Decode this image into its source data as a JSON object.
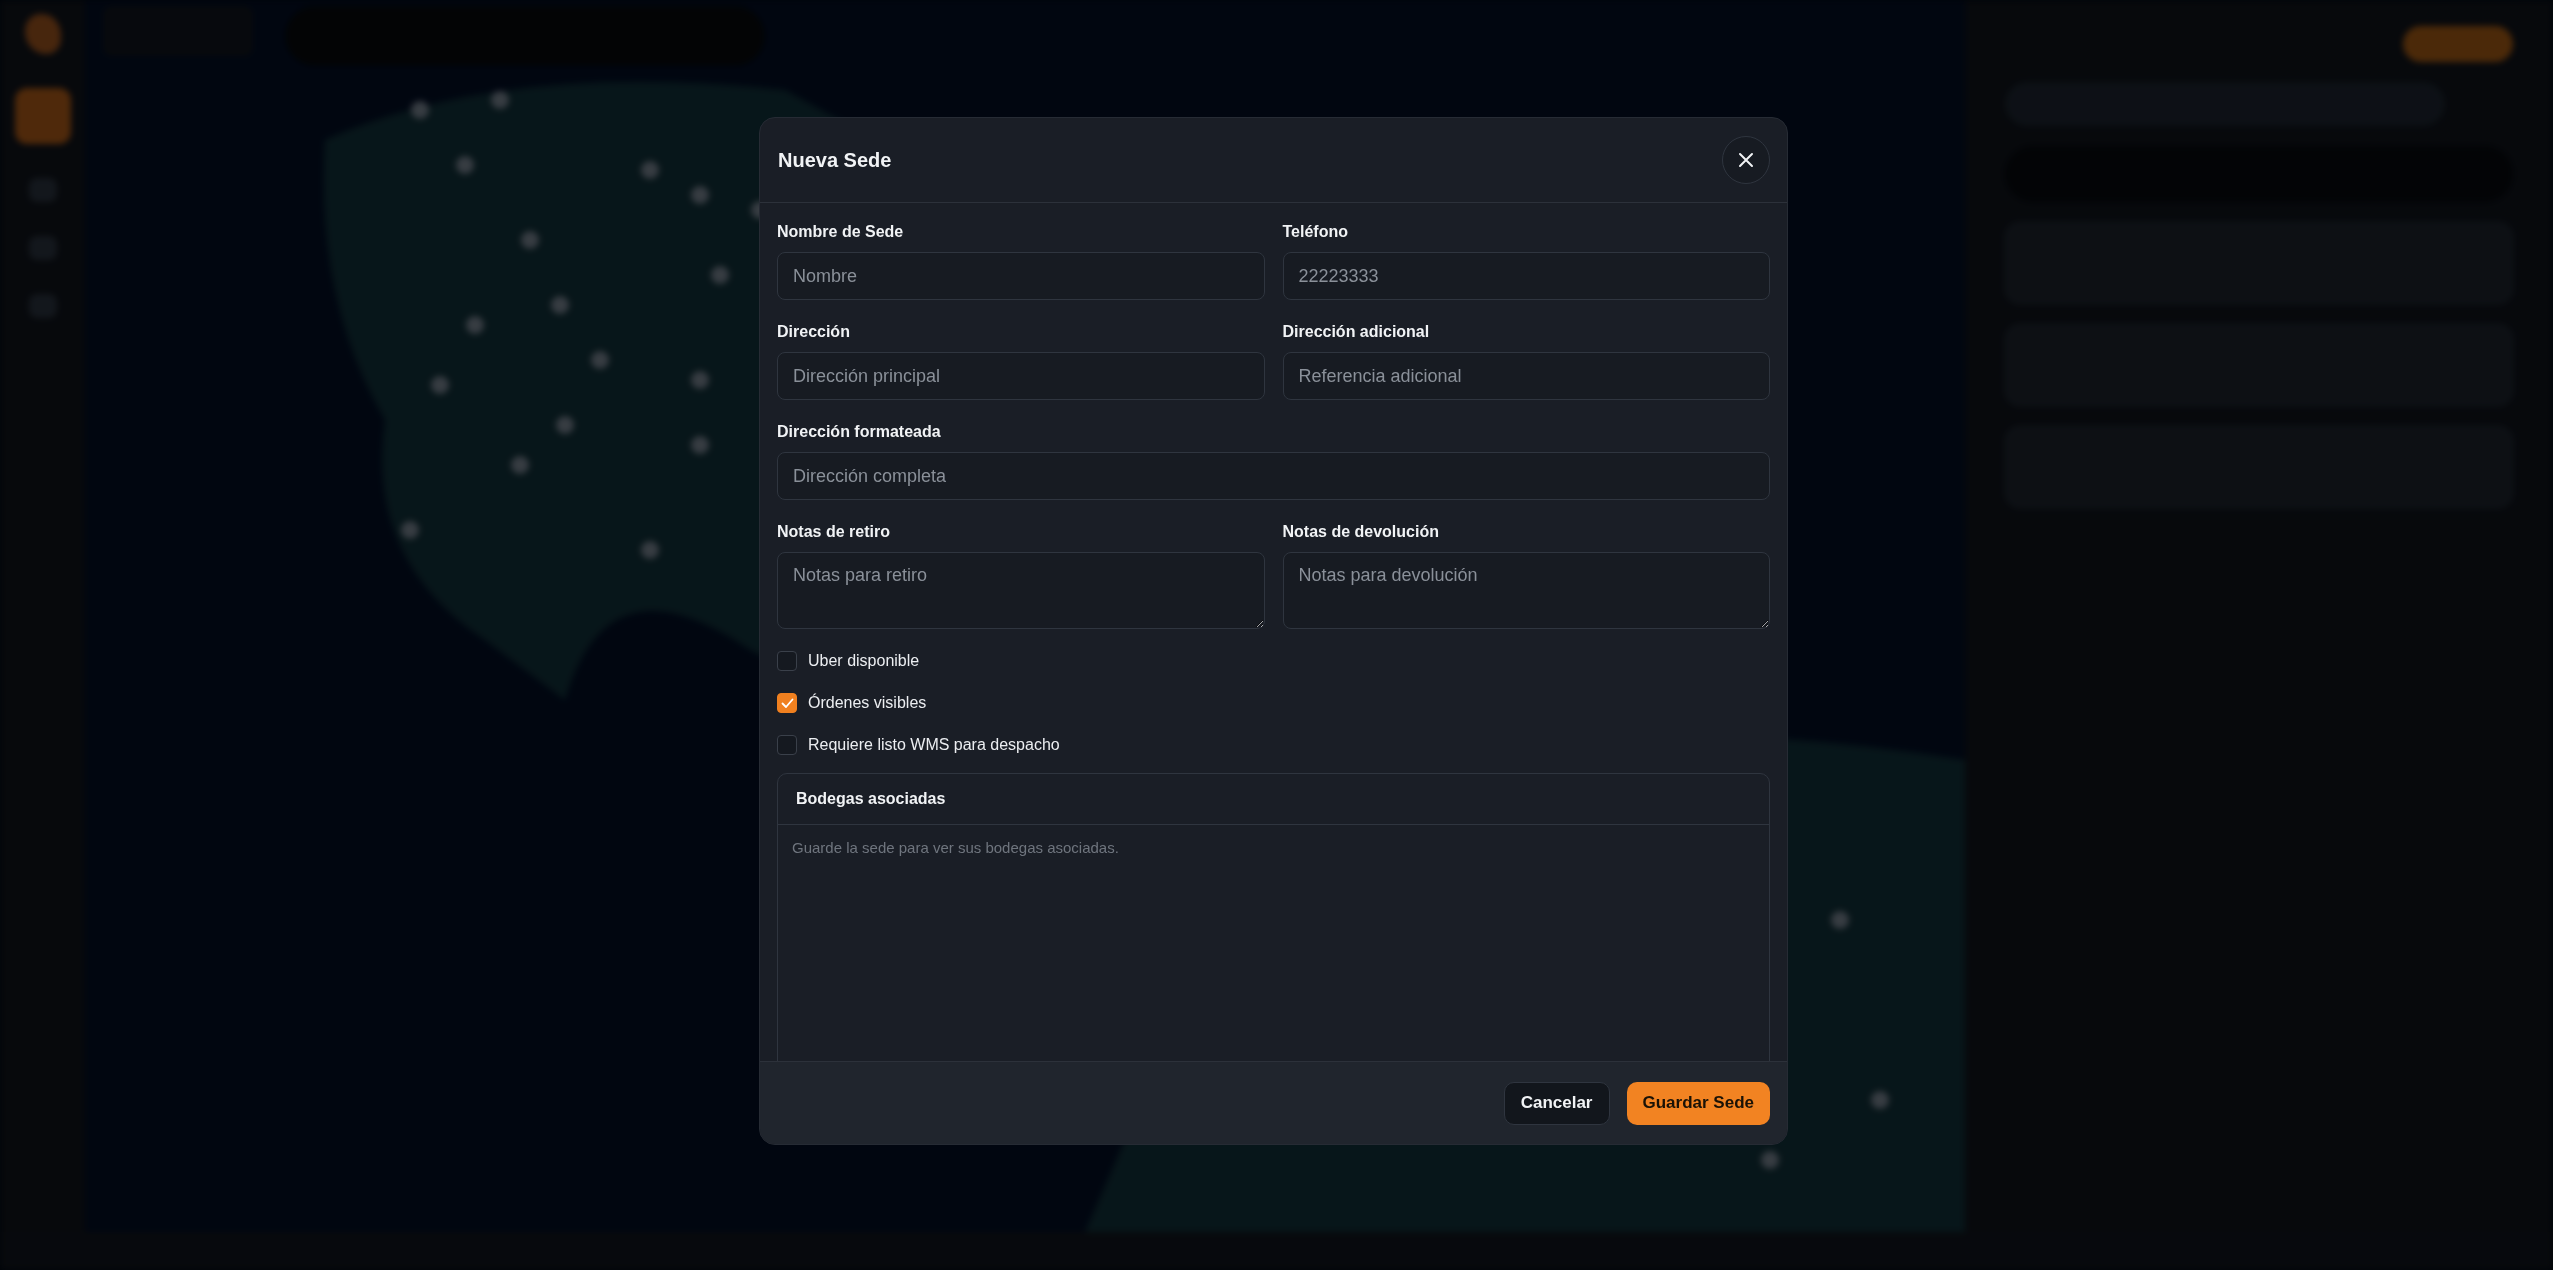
{
  "modal": {
    "title": "Nueva Sede",
    "field_rows": [
      [
        {
          "label": "Nombre de Sede",
          "placeholder": "Nombre",
          "kind": "input"
        },
        {
          "label": "Teléfono",
          "placeholder": "22223333",
          "kind": "input"
        }
      ],
      [
        {
          "label": "Dirección",
          "placeholder": "Dirección principal",
          "kind": "input"
        },
        {
          "label": "Dirección adicional",
          "placeholder": "Referencia adicional",
          "kind": "input"
        }
      ],
      [
        {
          "label": "Dirección formateada",
          "placeholder": "Dirección completa",
          "kind": "input"
        }
      ],
      [
        {
          "label": "Notas de retiro",
          "placeholder": "Notas para retiro",
          "kind": "textarea"
        },
        {
          "label": "Notas de devolución",
          "placeholder": "Notas para devolución",
          "kind": "textarea"
        }
      ]
    ],
    "checkboxes": [
      {
        "label": "Uber disponible",
        "checked": false
      },
      {
        "label": "Órdenes visibles",
        "checked": true
      },
      {
        "label": "Requiere listo WMS para despacho",
        "checked": false
      }
    ],
    "section": {
      "title": "Bodegas asociadas",
      "empty_message": "Guarde la sede para ver sus bodegas asociadas."
    },
    "buttons": [
      {
        "label": "Cancelar",
        "kind": "secondary"
      },
      {
        "label": "Guardar Sede",
        "kind": "primary"
      }
    ]
  }
}
